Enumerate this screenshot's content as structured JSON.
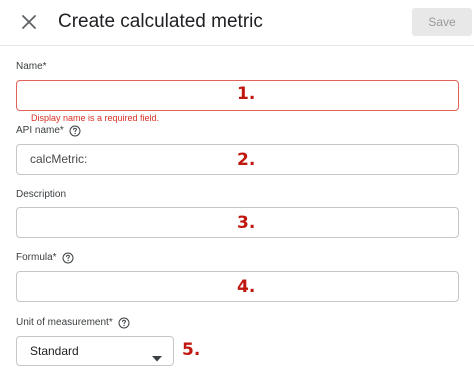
{
  "header": {
    "title": "Create calculated metric",
    "save_label": "Save",
    "close_icon": "close-icon"
  },
  "fields": {
    "name": {
      "label": "Name*",
      "value": "",
      "error": "Display name is a required field.",
      "marker": "1."
    },
    "api_name": {
      "label": "API name*",
      "value": "calcMetric:",
      "marker": "2.",
      "help_icon": "help-icon"
    },
    "description": {
      "label": "Description",
      "value": "",
      "marker": "3."
    },
    "formula": {
      "label": "Formula*",
      "value": "",
      "marker": "4.",
      "help_icon": "help-icon"
    },
    "unit": {
      "label": "Unit of measurement*",
      "selected": "Standard",
      "marker": "5.",
      "help_icon": "help-icon",
      "caret_icon": "caret-down-icon"
    }
  },
  "colors": {
    "error": "#d93025",
    "error_border": "#e0645c",
    "marker": "#c0180f",
    "save_disabled_bg": "#e8e8e8"
  }
}
